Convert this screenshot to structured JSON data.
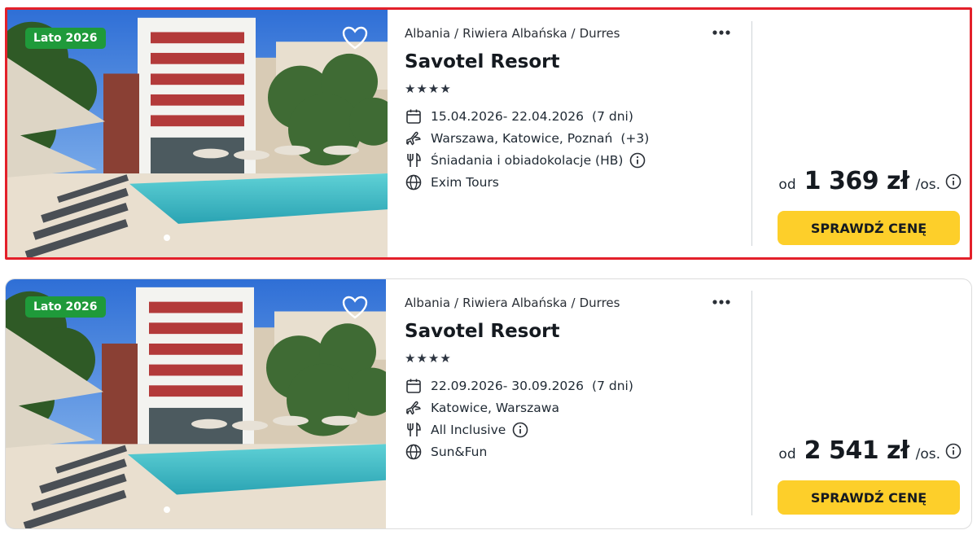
{
  "colors": {
    "highlight_border": "#e3202a",
    "season_badge_bg": "#1f9a3a",
    "cta_bg": "#fdcf2a",
    "text_dark": "#151a20"
  },
  "icons": {
    "favorite": "heart-outline-icon",
    "more": "three-dots-icon",
    "dates": "calendar-icon",
    "departure": "airplane-icon",
    "board": "fork-knife-icon",
    "operator": "globe-icon",
    "info": "info-circle-icon"
  },
  "offers": [
    {
      "season_badge": "Lato 2026",
      "breadcrumb": [
        "Albania",
        "Riwiera Albańska",
        "Durres"
      ],
      "hotel_name": "Savotel Resort",
      "stars": "★★★★",
      "dates": "15.04.2026- 22.04.2026",
      "duration": "(7 dni)",
      "departure": "Warszawa, Katowice, Poznań",
      "departure_extra": "(+3)",
      "board": "Śniadania i obiadokolacje (HB)",
      "operator": "Exim Tours",
      "price_from": "od",
      "price": "1 369 zł",
      "price_unit": "/os.",
      "cta": "SPRAWDŹ CENĘ"
    },
    {
      "season_badge": "Lato 2026",
      "breadcrumb": [
        "Albania",
        "Riwiera Albańska",
        "Durres"
      ],
      "hotel_name": "Savotel Resort",
      "stars": "★★★★",
      "dates": "22.09.2026- 30.09.2026",
      "duration": "(7 dni)",
      "departure": "Katowice, Warszawa",
      "departure_extra": "",
      "board": "All Inclusive",
      "operator": "Sun&Fun",
      "price_from": "od",
      "price": "2 541 zł",
      "price_unit": "/os.",
      "cta": "SPRAWDŹ CENĘ"
    }
  ],
  "breadcrumb_separator": "/"
}
